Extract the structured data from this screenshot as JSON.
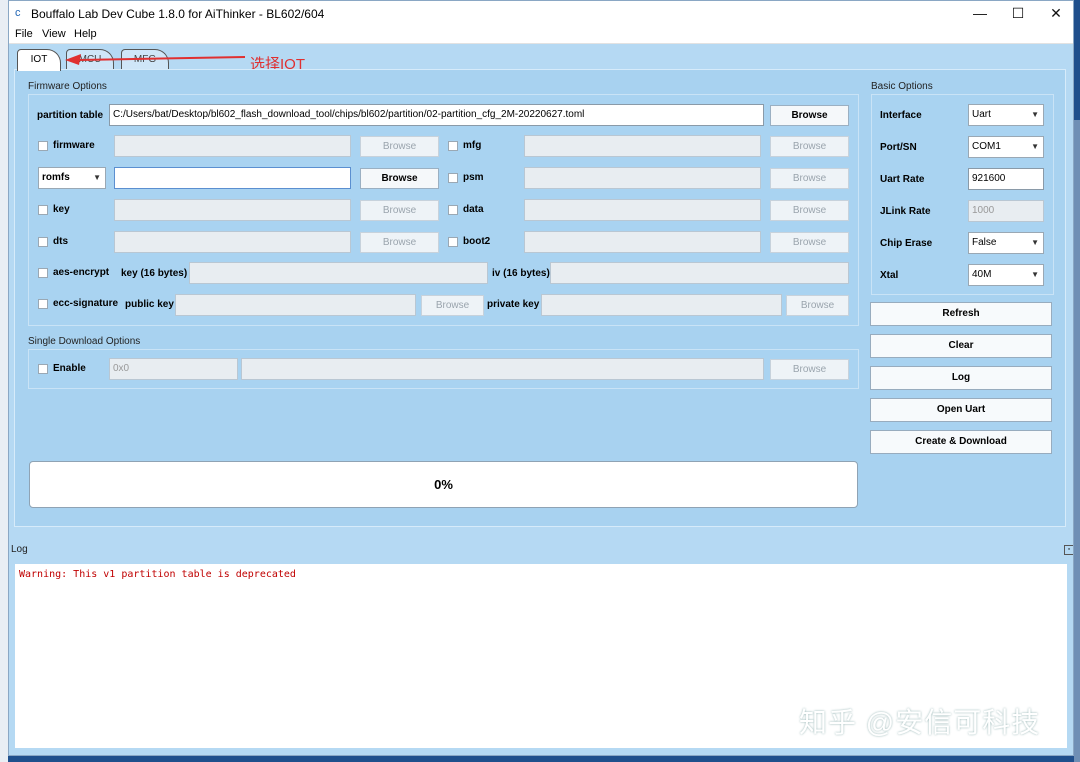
{
  "window": {
    "title": "Bouffalo Lab Dev Cube 1.8.0 for AiThinker - BL602/604"
  },
  "menu": {
    "file": "File",
    "view": "View",
    "help": "Help"
  },
  "tabs": [
    {
      "label": "IOT"
    },
    {
      "label": "MCU"
    },
    {
      "label": "MFG"
    }
  ],
  "annotation": {
    "text": "选择IOT",
    "color": "#e03030"
  },
  "firmware": {
    "group_label": "Firmware Options",
    "partition_label": "partition table",
    "partition_path": "C:/Users/bat/Desktop/bl602_flash_download_tool/chips/bl602/partition/02-partition_cfg_2M-20220627.toml",
    "browse": "Browse",
    "firmware_label": "firmware",
    "romfs_select": "romfs",
    "key_label": "key",
    "dts_label": "dts",
    "mfg_label": "mfg",
    "psm_label": "psm",
    "data_label": "data",
    "boot2_label": "boot2",
    "aes_label": "aes-encrypt",
    "key16_label": "key (16 bytes)",
    "iv16_label": "iv (16 bytes)",
    "ecc_label": "ecc-signature",
    "public_key_label": "public key",
    "private_key_label": "private key"
  },
  "single": {
    "group_label": "Single Download Options",
    "enable_label": "Enable",
    "address_placeholder": "0x0",
    "browse": "Browse"
  },
  "basic": {
    "group_label": "Basic Options",
    "interface_label": "Interface",
    "interface_value": "Uart",
    "port_label": "Port/SN",
    "port_value": "COM1",
    "uart_rate_label": "Uart Rate",
    "uart_rate_value": "921600",
    "jlink_rate_label": "JLink Rate",
    "jlink_rate_value": "1000",
    "chip_erase_label": "Chip Erase",
    "chip_erase_value": "False",
    "xtal_label": "Xtal",
    "xtal_value": "40M"
  },
  "actions": {
    "refresh": "Refresh",
    "clear": "Clear",
    "log": "Log",
    "open_uart": "Open Uart",
    "create_download": "Create & Download"
  },
  "progress": {
    "value": 0,
    "text": "0%"
  },
  "log": {
    "title": "Log",
    "lines": [
      "Warning: This v1 partition table is deprecated"
    ]
  },
  "watermark": "知乎 @安信可科技"
}
